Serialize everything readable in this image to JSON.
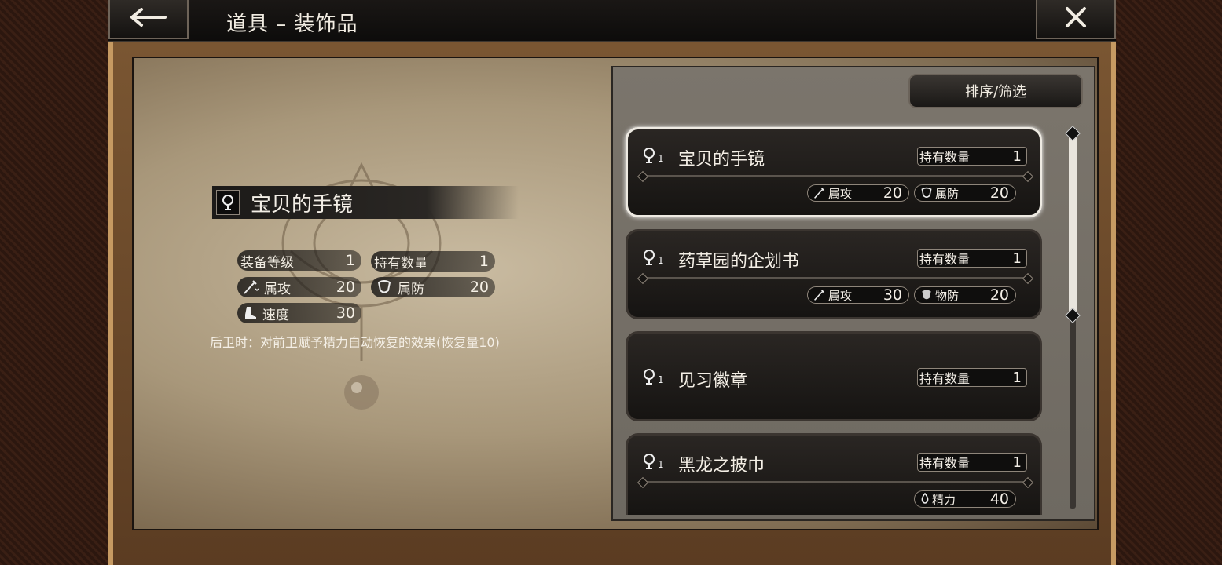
{
  "header": {
    "title": "道具 – 装饰品",
    "back_icon": "arrow-left-icon",
    "close_icon": "close-icon"
  },
  "detail": {
    "name": "宝贝的手镜",
    "icon": "accessory-icon",
    "stats": {
      "equip_level_label": "装备等级",
      "equip_level_value": "1",
      "owned_label": "持有数量",
      "owned_value": "1",
      "attr_attack_label": "属攻",
      "attr_attack_value": "20",
      "attr_defense_label": "属防",
      "attr_defense_value": "20",
      "speed_label": "速度",
      "speed_value": "30"
    },
    "description": "后卫时：对前卫赋予精力自动恢复的效果(恢复量10)"
  },
  "list": {
    "sort_label": "排序/筛选",
    "items": [
      {
        "level": "1",
        "name": "宝贝的手镜",
        "qty_label": "持有数量",
        "qty_value": "1",
        "stat1_label": "属攻",
        "stat1_value": "20",
        "stat2_label": "属防",
        "stat2_value": "20",
        "selected": true
      },
      {
        "level": "1",
        "name": "药草园的企划书",
        "qty_label": "持有数量",
        "qty_value": "1",
        "stat1_label": "属攻",
        "stat1_value": "30",
        "stat2_label": "物防",
        "stat2_value": "20"
      },
      {
        "level": "1",
        "name": "见习徽章",
        "qty_label": "持有数量",
        "qty_value": "1"
      },
      {
        "level": "1",
        "name": "黑龙之披巾",
        "qty_label": "持有数量",
        "qty_value": "1",
        "stat1_label": "精力",
        "stat1_value": "40"
      }
    ]
  },
  "colors": {
    "panel_dark": "#1a1816",
    "parchment": "#b8a88c",
    "selected_border": "#eeeae2"
  }
}
